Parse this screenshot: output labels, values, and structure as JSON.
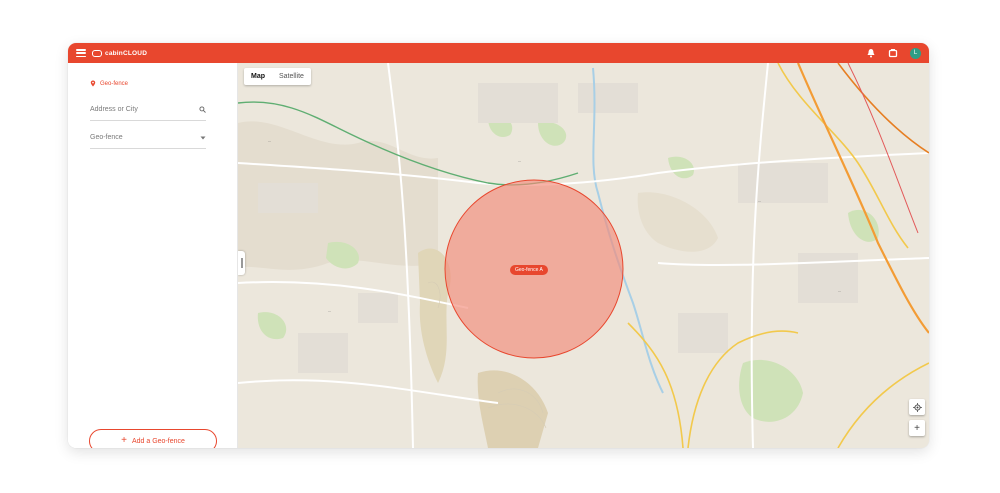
{
  "header": {
    "brand": "cabinCLOUD",
    "avatar_initial": "L"
  },
  "sidebar": {
    "title": "Geo-fence",
    "search": {
      "placeholder": "Address or City"
    },
    "select": {
      "value": "Geo-fence"
    },
    "add_button": "Add a Geo-fence"
  },
  "map": {
    "tabs": [
      {
        "label": "Map",
        "active": true
      },
      {
        "label": "Satellite",
        "active": false
      }
    ],
    "fence_label": "Geo-fence A"
  },
  "colors": {
    "brand": "#e8472e",
    "fence_fill": "#f28b7a",
    "avatar": "#2e9e86"
  },
  "icons": [
    "menu-icon",
    "bell-icon",
    "box-icon",
    "pin-icon",
    "search-icon",
    "chevron-down-icon",
    "plus-icon",
    "locate-icon",
    "zoom-in-icon"
  ]
}
